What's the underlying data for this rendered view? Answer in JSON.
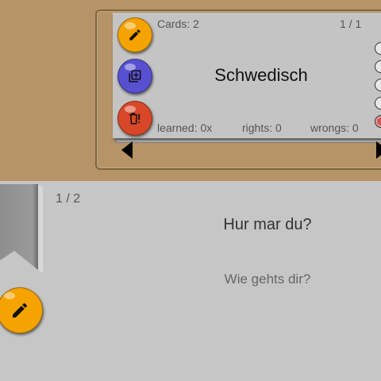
{
  "deck": {
    "cards_label": "Cards: 2",
    "page": "1 / 1",
    "title": "Schwedisch",
    "learned": "learned: 0x",
    "rights": "rights: 0",
    "wrongs": "wrongs: 0",
    "radio_count": 5,
    "selected_radio": 5
  },
  "buttons": {
    "edit_deck": {
      "icon": "pencil-icon",
      "color": "#f5a300"
    },
    "copy_deck": {
      "icon": "copy-icon",
      "color": "#5750d0"
    },
    "delete_deck": {
      "icon": "delete-icon",
      "color": "#d84828"
    },
    "edit_card": {
      "icon": "pencil-icon",
      "color": "#f5a300"
    }
  },
  "card_view": {
    "page": "1 / 2",
    "question": "Hur mar du?",
    "answer": "Wie gehts dir?"
  },
  "colors": {
    "desk": "#b69467",
    "card": "#c4c4c4",
    "panel": "#c6c6c6"
  }
}
